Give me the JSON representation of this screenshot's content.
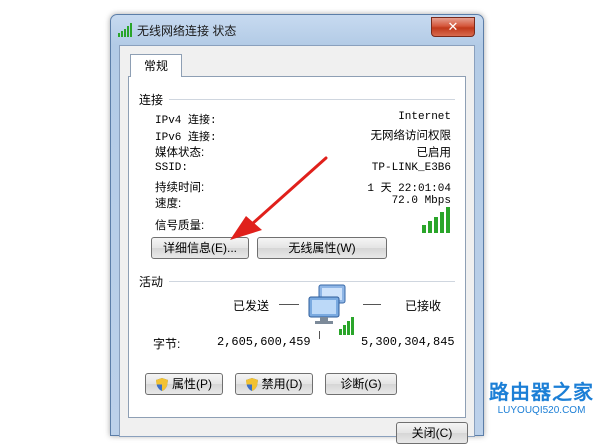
{
  "window": {
    "title": "无线网络连接 状态",
    "close_label": "✕",
    "title_icon": "signal-bars-icon"
  },
  "tabs": [
    {
      "label": "常规"
    }
  ],
  "connection": {
    "heading": "连接",
    "rows": [
      {
        "label": "IPv4 连接:",
        "value": "Internet"
      },
      {
        "label": "IPv6 连接:",
        "value": "无网络访问权限"
      },
      {
        "label": "媒体状态:",
        "value": "已启用"
      },
      {
        "label": "SSID:",
        "value": "TP-LINK_E3B6"
      },
      {
        "label": "持续时间:",
        "value": "1 天 22:01:04"
      },
      {
        "label": "速度:",
        "value": "72.0 Mbps"
      }
    ],
    "signal_label": "信号质量:",
    "signal_bars_lit": 5,
    "signal_bars_total": 5,
    "details_button": "详细信息(E)...",
    "wireless_props_button": "无线属性(W)"
  },
  "activity": {
    "heading": "活动",
    "sent_label": "已发送",
    "received_label": "已接收",
    "bytes_label": "字节:",
    "bytes_sent": "2,605,600,459",
    "bytes_received": "5,300,304,845",
    "network_icon": "network-computers-icon"
  },
  "bottom_buttons": {
    "properties": "属性(P)",
    "disable": "禁用(D)",
    "diagnose": "诊断(G)"
  },
  "footer": {
    "close_button": "关闭(C)"
  },
  "watermark": {
    "main": "路由器之家",
    "sub": "LUYOUQI520.COM"
  },
  "colors": {
    "arrow": "#e0201b",
    "signal": "#2aa52a",
    "title_bar": "#b3cbe6"
  }
}
